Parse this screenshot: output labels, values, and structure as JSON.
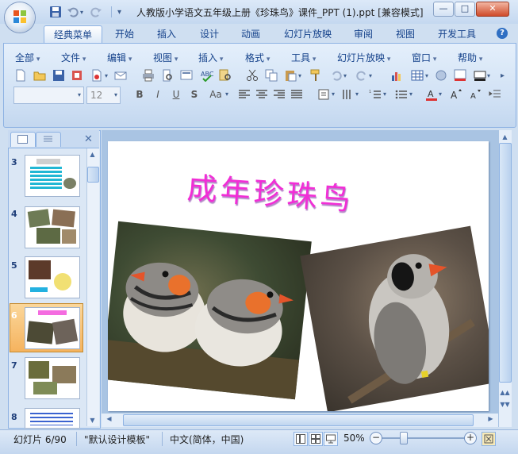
{
  "window": {
    "title": "人教版小学语文五年级上册《珍珠鸟》课件_PPT (1).ppt [兼容模式]",
    "min": "—",
    "max": "□",
    "close": "✕"
  },
  "ribbon_tabs": [
    "经典菜单",
    "开始",
    "插入",
    "设计",
    "动画",
    "幻灯片放映",
    "审阅",
    "视图",
    "开发工具"
  ],
  "active_tab": "经典菜单",
  "menus": [
    "全部",
    "文件",
    "编辑",
    "视图",
    "插入",
    "格式",
    "工具",
    "幻灯片放映",
    "窗口",
    "帮助"
  ],
  "font": {
    "name_value": "",
    "size_value": "12"
  },
  "format_buttons": [
    "B",
    "I",
    "U",
    "S",
    "Aa"
  ],
  "slides": [
    {
      "number": "3"
    },
    {
      "number": "4"
    },
    {
      "number": "5"
    },
    {
      "number": "6",
      "selected": true
    },
    {
      "number": "7"
    },
    {
      "number": "8"
    }
  ],
  "current_slide": {
    "title": "成年珍珠鸟"
  },
  "status": {
    "slide_info": "幻灯片 6/90",
    "template": "\"默认设计模板\"",
    "language": "中文(简体，中国)",
    "zoom": "50%"
  },
  "colors": {
    "title_text": "#f12ed6",
    "accent": "#15428b",
    "selected_thumb": "#f5b35e"
  }
}
